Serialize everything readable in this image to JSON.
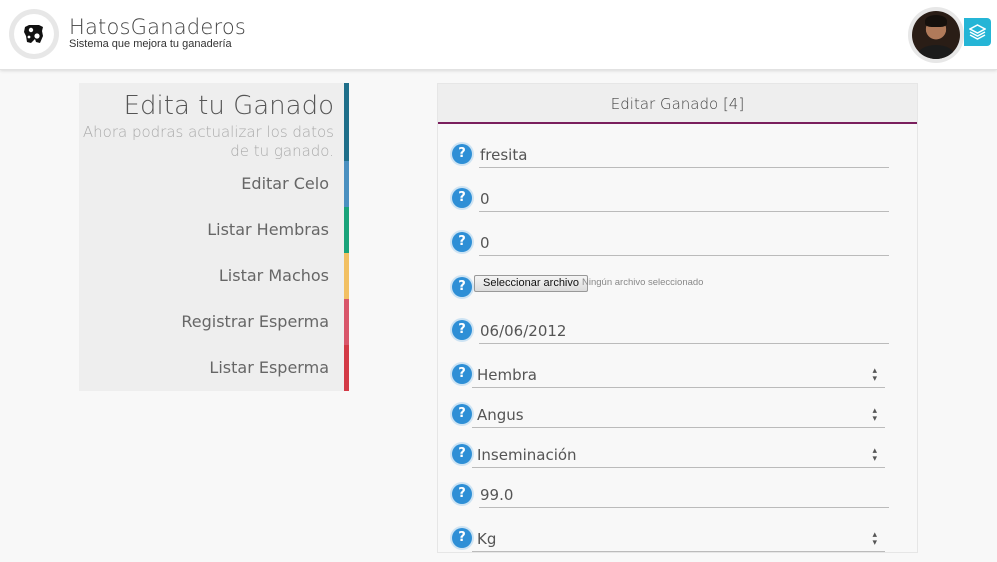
{
  "header": {
    "brand_title": "HatosGanaderos",
    "brand_subtitle": "Sistema que mejora tu ganadería",
    "logo_icon": "cow-icon",
    "avatar_icon": "user-avatar",
    "layers_icon": "layers-icon",
    "accent": "#25b5d6"
  },
  "sidebar": {
    "title": "Edita tu Ganado",
    "description": "Ahora podras actualizar los datos de tu ganado.",
    "items": [
      {
        "label": "Editar Celo",
        "color": "#4a90c0"
      },
      {
        "label": "Listar Hembras",
        "color": "#1aa37a"
      },
      {
        "label": "Listar Machos",
        "color": "#f2c063"
      },
      {
        "label": "Registrar Esperma",
        "color": "#d9566a"
      },
      {
        "label": "Listar Esperma",
        "color": "#d33a46"
      }
    ]
  },
  "form": {
    "title": "Editar Ganado [4]",
    "help_glyph": "?",
    "fields": {
      "name": "fresita",
      "field2": "0",
      "field3": "0",
      "file_button": "Seleccionar archivo",
      "file_status": "Ningún archivo seleccionado",
      "date": "06/06/2012",
      "sex": "Hembra",
      "breed": "Angus",
      "origin": "Inseminación",
      "weight": "99.0",
      "unit": "Kg"
    },
    "select_arrow": "⌃⌄"
  }
}
